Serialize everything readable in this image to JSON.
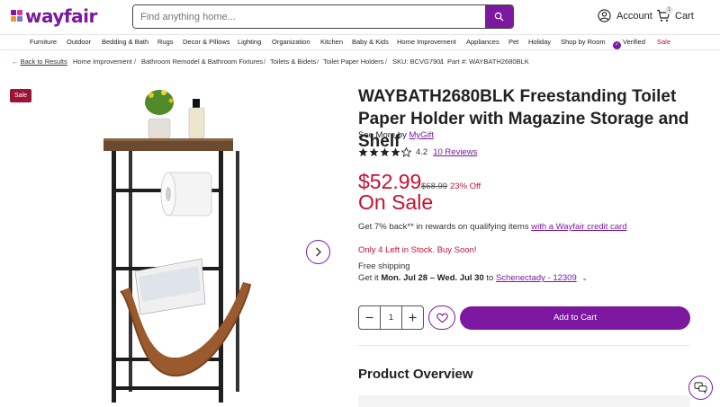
{
  "brand": {
    "name": "wayfair",
    "color": "#7b189f",
    "logo_colors": [
      "#7b189f",
      "#cf3a9f",
      "#f19436",
      "#6d7bd0"
    ]
  },
  "search": {
    "placeholder": "Find anything home..."
  },
  "header": {
    "account_label": "Account",
    "cart_label": "Cart",
    "cart_count": "1"
  },
  "nav": {
    "items": [
      "Furniture",
      "Outdoor",
      "Bedding & Bath",
      "Rugs",
      "Decor & Pillows",
      "Lighting",
      "Organization",
      "Kitchen",
      "Baby & Kids",
      "Home Improvement",
      "Appliances",
      "Pet",
      "Holiday",
      "Shop by Room",
      "Verified",
      "Sale"
    ]
  },
  "breadcrumb": {
    "back": "Back to Results",
    "items": [
      "Home Improvement",
      "Bathroom Remodel & Bathroom Fixtures",
      "Toilets & Bidets",
      "Toilet Paper Holders",
      "SKU: BCVG7901",
      "Part #: WAYBATH2680BLK"
    ]
  },
  "gallery": {
    "sale_tag": "Sale",
    "next_icon": "chevron-right-icon"
  },
  "product": {
    "title": "WAYBATH2680BLK Freestanding Toilet Paper Holder with Magazine Storage and Shelf",
    "see_more_prefix": "See More by",
    "brand": "MyGift",
    "rating": "4.2",
    "rating_stars": 4.2,
    "reviews": "10 Reviews",
    "price": "$52.99",
    "original_price": "$68.99",
    "discount": "23% Off",
    "sale_label": "On Sale",
    "rewards_text": "Get 7% back** in rewards on qualifying items",
    "rewards_link": "with a Wayfair credit card",
    "stock": "Only 4 Left in Stock. Buy Soon!",
    "shipping": "Free shipping",
    "delivery_prefix": "Get it",
    "delivery_dates": "Mon. Jul 28 – Wed. Jul 30",
    "delivery_to": "to",
    "location": "Schenectady - 12309",
    "quantity": "1",
    "add_to_cart": "Add to Cart",
    "overview_heading": "Product Overview",
    "accent_red": "#c8102e"
  }
}
